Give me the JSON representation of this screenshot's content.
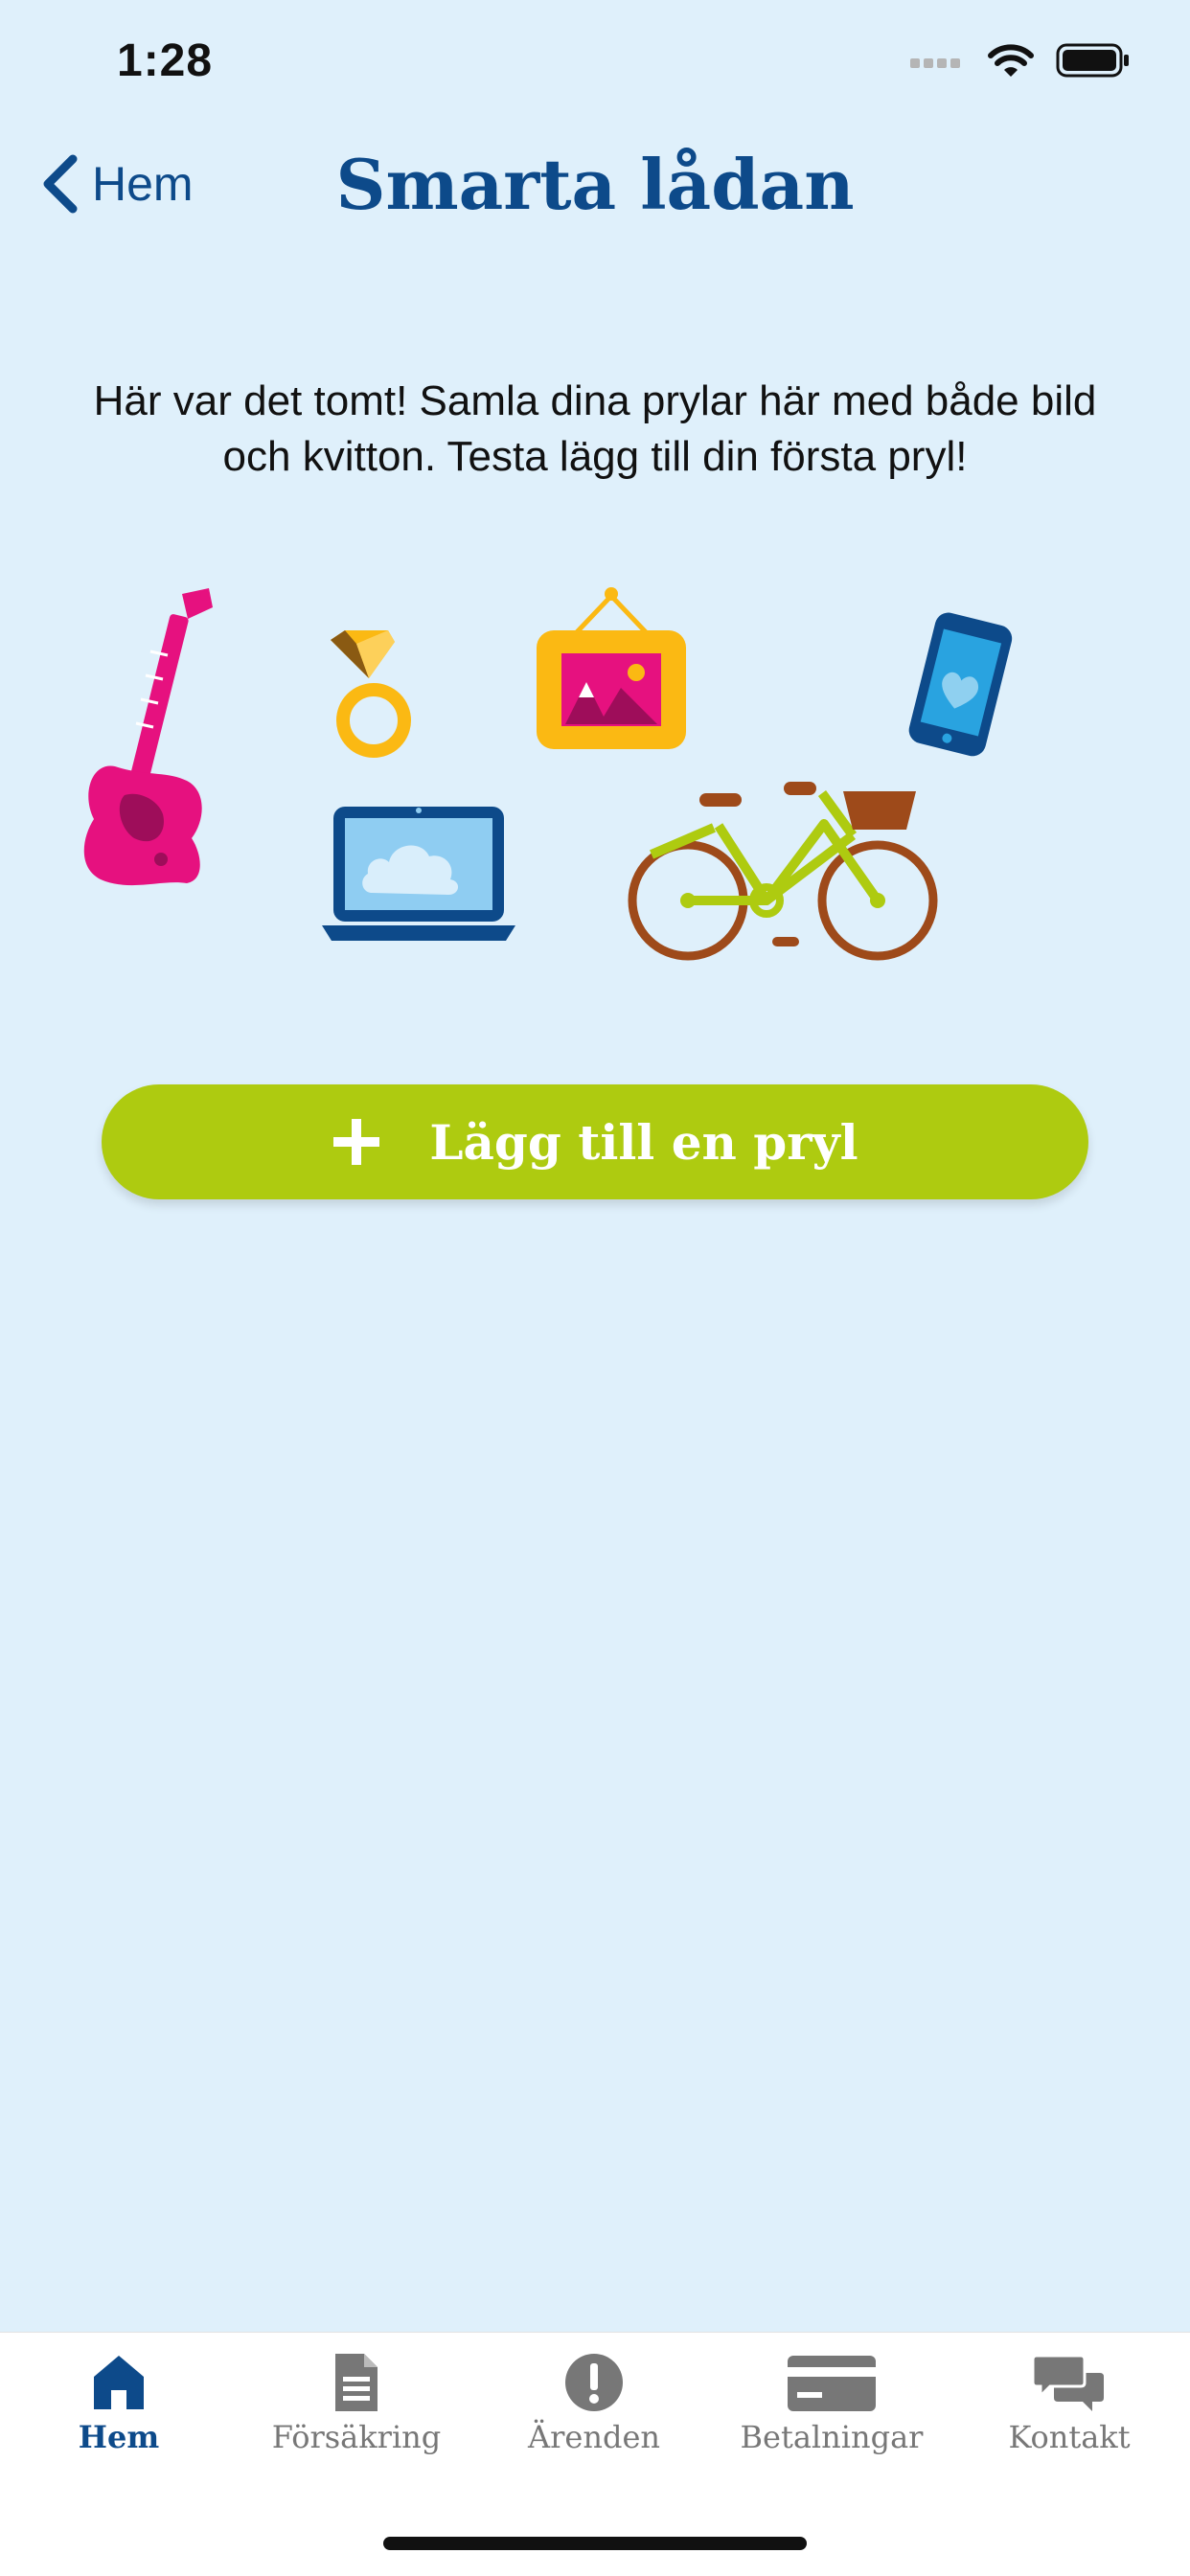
{
  "status_bar": {
    "time": "1:28"
  },
  "nav": {
    "back_label": "Hem",
    "title": "Smarta lådan"
  },
  "empty_state": {
    "message": "Här var det tomt! Samla dina prylar här med både bild och kvitton. Testa lägg till din första pryl!",
    "illustrations": [
      "guitar",
      "ring",
      "framed-picture",
      "phone-heart",
      "laptop-cloud",
      "bicycle"
    ]
  },
  "add_button": {
    "label": "Lägg till en pryl",
    "icon": "plus-icon"
  },
  "tabbar": {
    "items": [
      {
        "label": "Hem",
        "icon": "home-icon",
        "active": true
      },
      {
        "label": "Försäkring",
        "icon": "document-icon",
        "active": false
      },
      {
        "label": "Ärenden",
        "icon": "exclamation-icon",
        "active": false
      },
      {
        "label": "Betalningar",
        "icon": "credit-card-icon",
        "active": false
      },
      {
        "label": "Kontakt",
        "icon": "chat-bubbles-icon",
        "active": false
      }
    ]
  },
  "colors": {
    "background": "#dff0fb",
    "primary": "#0d4a8a",
    "accent_green": "#aecb10",
    "tab_inactive": "#777777"
  }
}
